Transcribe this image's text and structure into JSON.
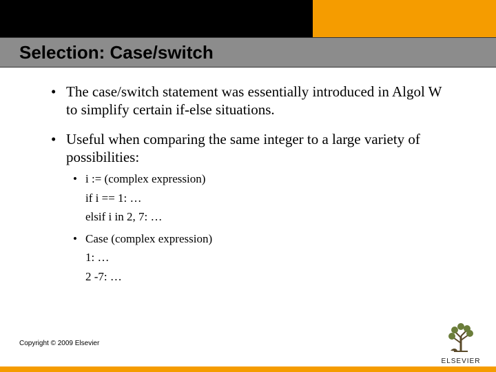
{
  "colors": {
    "accent_orange": "#f59c00",
    "title_band": "#8c8c8c",
    "top_bar": "#000000"
  },
  "title": "Selection: Case/switch",
  "bullets": [
    {
      "text": "The case/switch statement was essentially introduced in Algol W to simplify certain if-else situations."
    },
    {
      "text": "Useful when comparing the same integer to a large variety of possibilities:",
      "sub": [
        {
          "line1": "i := (complex expression)",
          "line2": "if i == 1: …",
          "line3": "elsif i in 2, 7: …"
        },
        {
          "line1": "Case (complex expression)",
          "line2": "1: …",
          "line3": "2 -7: …"
        }
      ]
    }
  ],
  "copyright": "Copyright © 2009 Elsevier",
  "logo": {
    "word": "ELSEVIER"
  }
}
